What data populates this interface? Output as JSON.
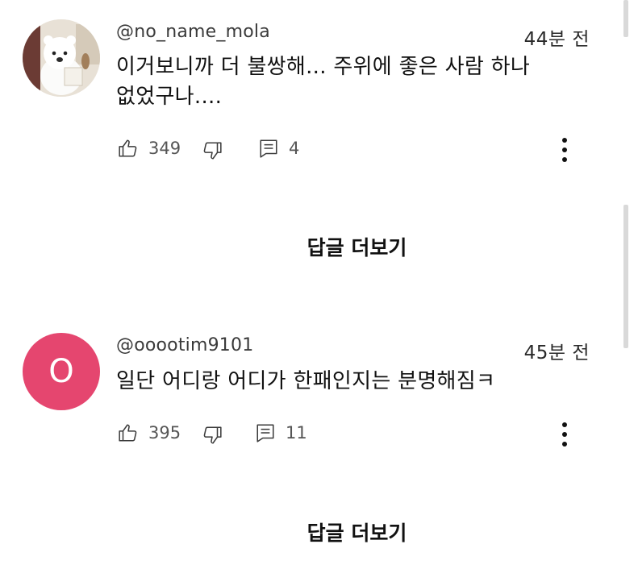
{
  "comments": [
    {
      "handle": "@no_name_mola",
      "time": "44분 전",
      "text": "이거보니까 더 불쌍해... 주위에 좋은 사람 하나 없었구나....",
      "likes": "349",
      "replies_count": "4",
      "avatar": {
        "type": "image",
        "description_icon": "polar-bear-avatar"
      }
    },
    {
      "handle": "@ooootim9101",
      "time": "45분 전",
      "text": "일단 어디랑 어디가 한패인지는 분명해짐ㅋ",
      "likes": "395",
      "replies_count": "11",
      "avatar": {
        "type": "letter",
        "letter": "O",
        "color": "#e5466f"
      }
    }
  ],
  "more_replies_label": "답글 더보기",
  "icons": [
    "thumbs-up-icon",
    "thumbs-down-icon",
    "reply-icon",
    "more-vert-icon"
  ]
}
